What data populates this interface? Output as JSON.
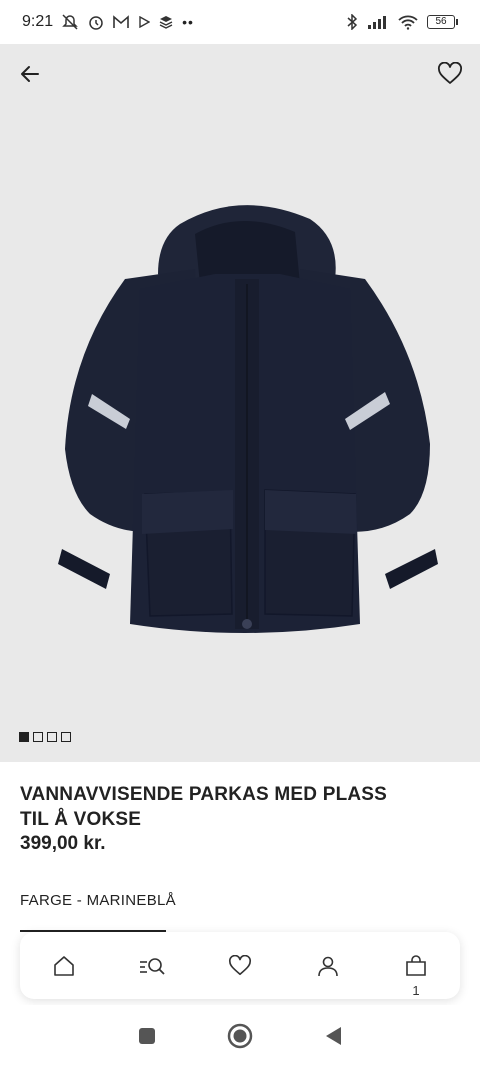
{
  "status_bar": {
    "time": "9:21",
    "battery": "56",
    "left_icons": [
      "mute-icon",
      "alarm-icon",
      "gmail-icon",
      "play-icon",
      "layers-icon",
      "more-dots-icon"
    ],
    "right_icons": [
      "bluetooth-icon",
      "signal-icon",
      "wifi-icon"
    ]
  },
  "header": {
    "back_icon": "arrow-left-icon",
    "favorite_icon": "heart-icon"
  },
  "gallery": {
    "image_alt": "navy parka jacket",
    "dots": [
      true,
      false,
      false,
      false
    ]
  },
  "product": {
    "title": "VANNAVVISENDE PARKAS MED PLASS TIL Å VOKSE",
    "price": "399,00 kr.",
    "color_label": "FARGE - MARINEBLÅ"
  },
  "bottom_nav": {
    "items": [
      {
        "icon": "home-icon"
      },
      {
        "icon": "search-menu-icon"
      },
      {
        "icon": "heart-icon"
      },
      {
        "icon": "account-icon"
      },
      {
        "icon": "bag-icon",
        "count": "1"
      }
    ]
  },
  "colors": {
    "hero_bg": "#e9e9e9",
    "jacket_navy": "#1c2236",
    "text": "#222222"
  }
}
